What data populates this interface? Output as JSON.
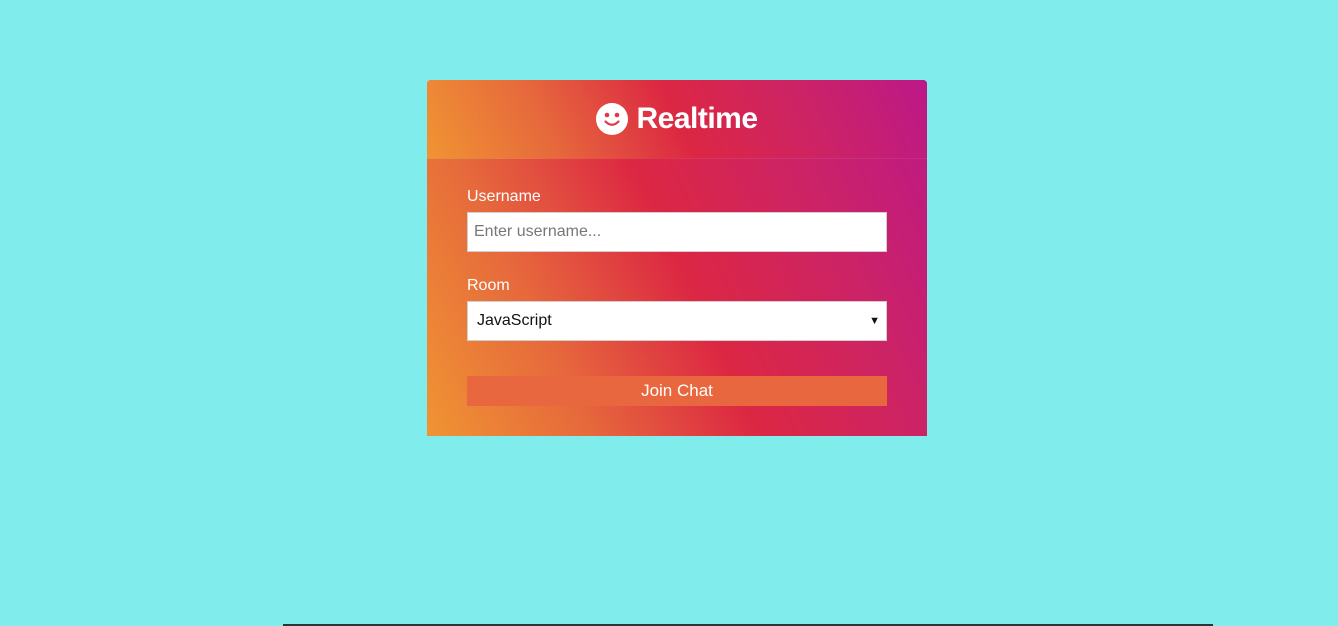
{
  "app": {
    "title": "Realtime",
    "logo_icon": "smile-icon"
  },
  "form": {
    "username_label": "Username",
    "username_placeholder": "Enter username...",
    "username_value": "",
    "room_label": "Room",
    "room_selected": "JavaScript",
    "join_button_label": "Join Chat"
  },
  "colors": {
    "background": "#81ecec",
    "gradient_start": "#f09433",
    "gradient_mid": "#dc2743",
    "gradient_end": "#bc1888",
    "button": "#e8673f"
  }
}
